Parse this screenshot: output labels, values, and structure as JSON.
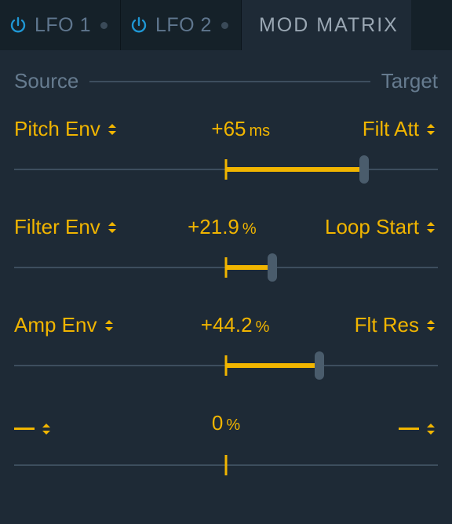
{
  "tabs": {
    "lfo1": {
      "label": "LFO 1"
    },
    "lfo2": {
      "label": "LFO 2"
    },
    "mod": {
      "label": "MOD MATRIX"
    }
  },
  "header": {
    "source": "Source",
    "target": "Target"
  },
  "colors": {
    "accent": "#f1b500",
    "power": "#1f97d4"
  },
  "rows": [
    {
      "source": "Pitch Env",
      "target": "Filt Att",
      "value": "+65",
      "unit": "ms",
      "pct": 65,
      "empty": false
    },
    {
      "source": "Filter Env",
      "target": "Loop Start",
      "value": "+21.9",
      "unit": "%",
      "pct": 21.9,
      "empty": false
    },
    {
      "source": "Amp Env",
      "target": "Flt Res",
      "value": "+44.2",
      "unit": "%",
      "pct": 44.2,
      "empty": false
    },
    {
      "source": "",
      "target": "",
      "value": "0",
      "unit": "%",
      "pct": 0,
      "empty": true
    }
  ]
}
